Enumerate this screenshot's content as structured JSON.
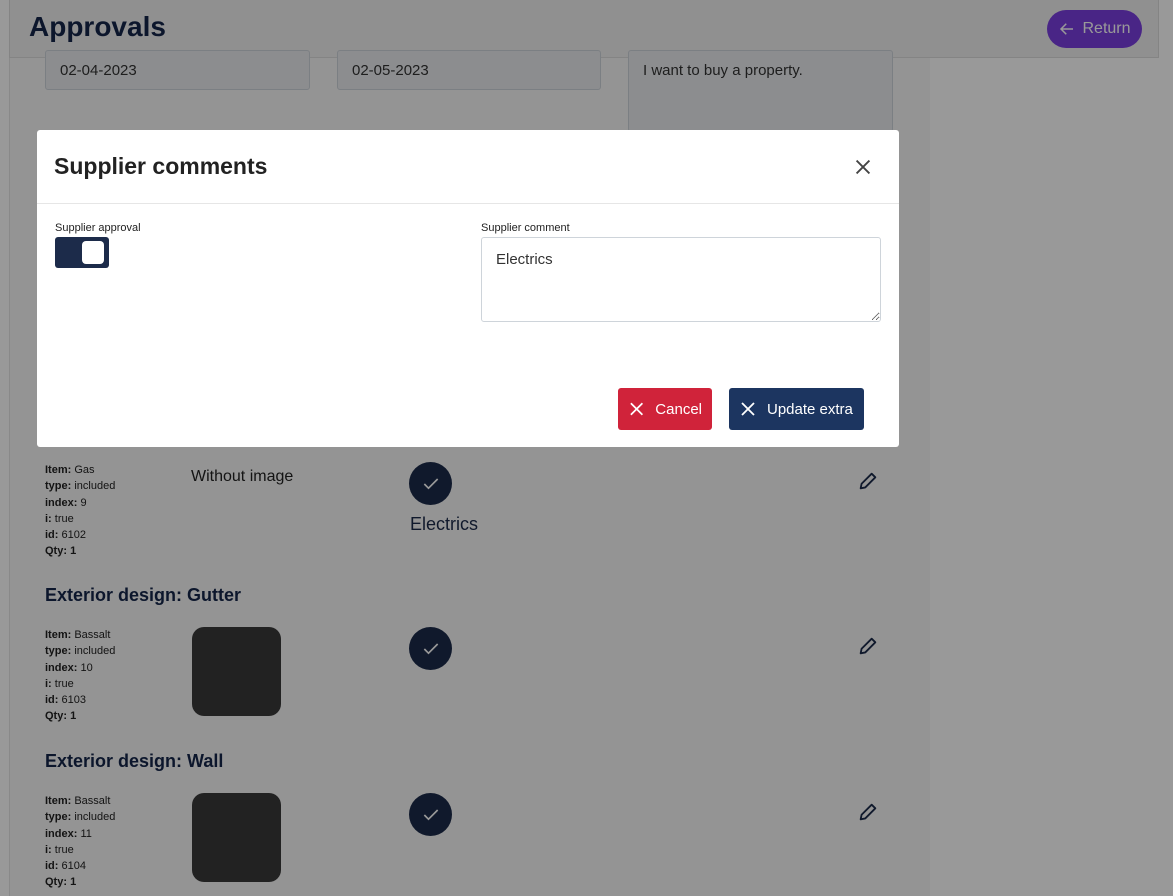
{
  "header": {
    "title": "Approvals",
    "return_label": "Return"
  },
  "form": {
    "date_start": "02-04-2023",
    "date_end": "02-05-2023",
    "description": "I want to buy a property."
  },
  "items": [
    {
      "section": "",
      "details": {
        "item": "Gas",
        "type": "included",
        "index": "9",
        "i": "true",
        "id": "6102",
        "qty": "1"
      },
      "image_text": "Without image",
      "comment": "Electrics"
    },
    {
      "section": "Exterior design: Gutter",
      "details": {
        "item": "Bassalt",
        "type": "included",
        "index": "10",
        "i": "true",
        "id": "6103",
        "qty": "1"
      }
    },
    {
      "section": "Exterior design: Wall",
      "details": {
        "item": "Bassalt",
        "type": "included",
        "index": "11",
        "i": "true",
        "id": "6104",
        "qty": "1"
      }
    }
  ],
  "labels": {
    "item": "Item:",
    "type": "type:",
    "index": "index:",
    "i": "i:",
    "id": "id:",
    "qty": "Qty:"
  },
  "modal": {
    "title": "Supplier comments",
    "approval_label": "Supplier approval",
    "approval_on": true,
    "comment_label": "Supplier comment",
    "comment_value": "Electrics",
    "cancel_label": "Cancel",
    "update_label": "Update extra"
  },
  "colors": {
    "navy": "#1c2b4a",
    "danger": "#d0233a",
    "purple": "#7a3fe0"
  }
}
